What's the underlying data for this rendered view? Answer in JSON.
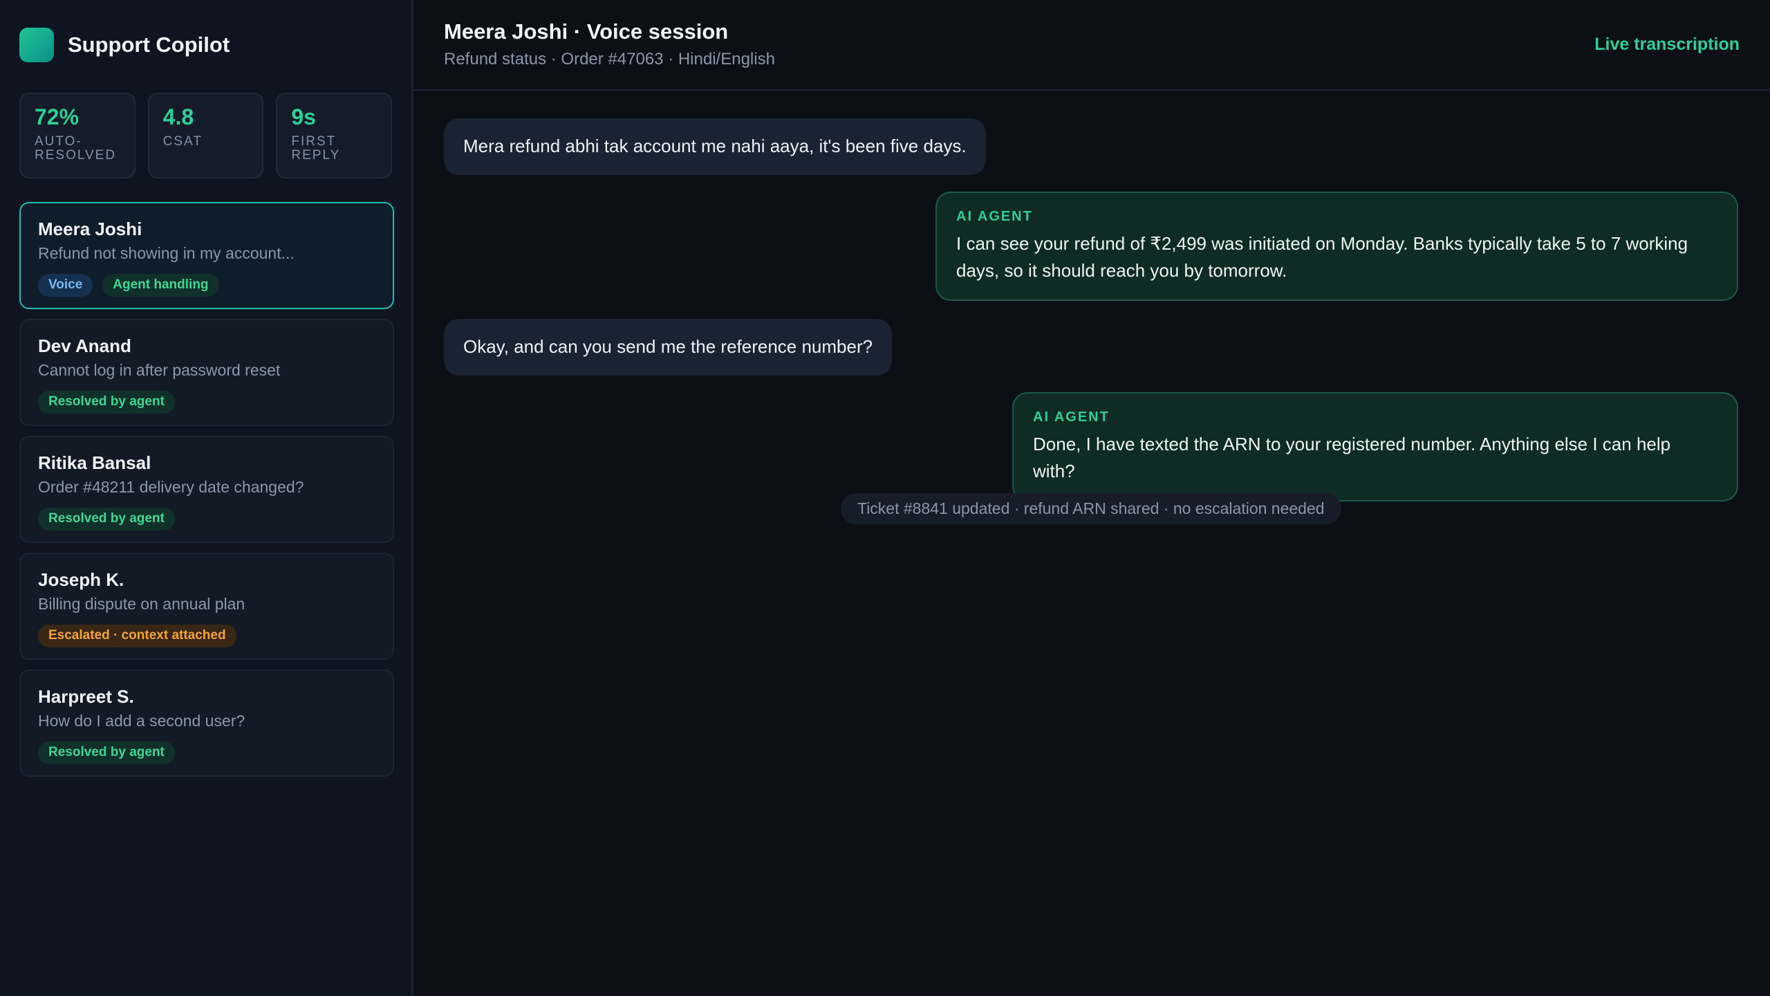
{
  "app": {
    "name": "Support Copilot",
    "logo_icon": "app-logo-icon"
  },
  "stats": [
    {
      "value": "72%",
      "label": "AUTO-\nRESOLVED"
    },
    {
      "value": "4.8",
      "label": "CSAT"
    },
    {
      "value": "9s",
      "label": "FIRST\nREPLY"
    }
  ],
  "conversations": [
    {
      "name": "Meera Joshi",
      "snippet": "Refund not showing in my account...",
      "tags": [
        "Voice",
        "Agent handling"
      ]
    },
    {
      "name": "Dev Anand",
      "snippet": "Cannot log in after password reset",
      "tags": [
        "Resolved by agent"
      ]
    },
    {
      "name": "Ritika Bansal",
      "snippet": "Order #48211 delivery date changed?",
      "tags": [
        "Resolved by agent"
      ]
    },
    {
      "name": "Joseph K.",
      "snippet": "Billing dispute on annual plan",
      "tags": [
        "Escalated · context attached"
      ]
    },
    {
      "name": "Harpreet S.",
      "snippet": "How do I add a second user?",
      "tags": [
        "Resolved by agent"
      ]
    }
  ],
  "header": {
    "title": "Meera Joshi · Voice session",
    "subtitle": "Refund status · Order #47063 · Hindi/English",
    "status": "Live transcription"
  },
  "messages": [
    {
      "role": "user",
      "text": "Mera refund abhi tak account me nahi aaya, it's been five days."
    },
    {
      "role": "agent",
      "label": "AI AGENT",
      "text": "I can see your refund of ₹2,499 was initiated on Monday. Banks typically take 5 to 7 working days, so it should reach you by tomorrow."
    },
    {
      "role": "user",
      "text": "Okay, and can you send me the reference number?"
    },
    {
      "role": "agent",
      "label": "AI AGENT",
      "text": "Done, I have texted the ARN to your registered number. Anything else I can help with?"
    }
  ],
  "system_note": "Ticket #8841 updated · refund ARN shared · no escalation needed",
  "colors": {
    "accent": "#2ecf95",
    "active_border": "#1fbdb0",
    "voice_tag": "#7ab8f5",
    "escalated_tag": "#f3a33a"
  }
}
